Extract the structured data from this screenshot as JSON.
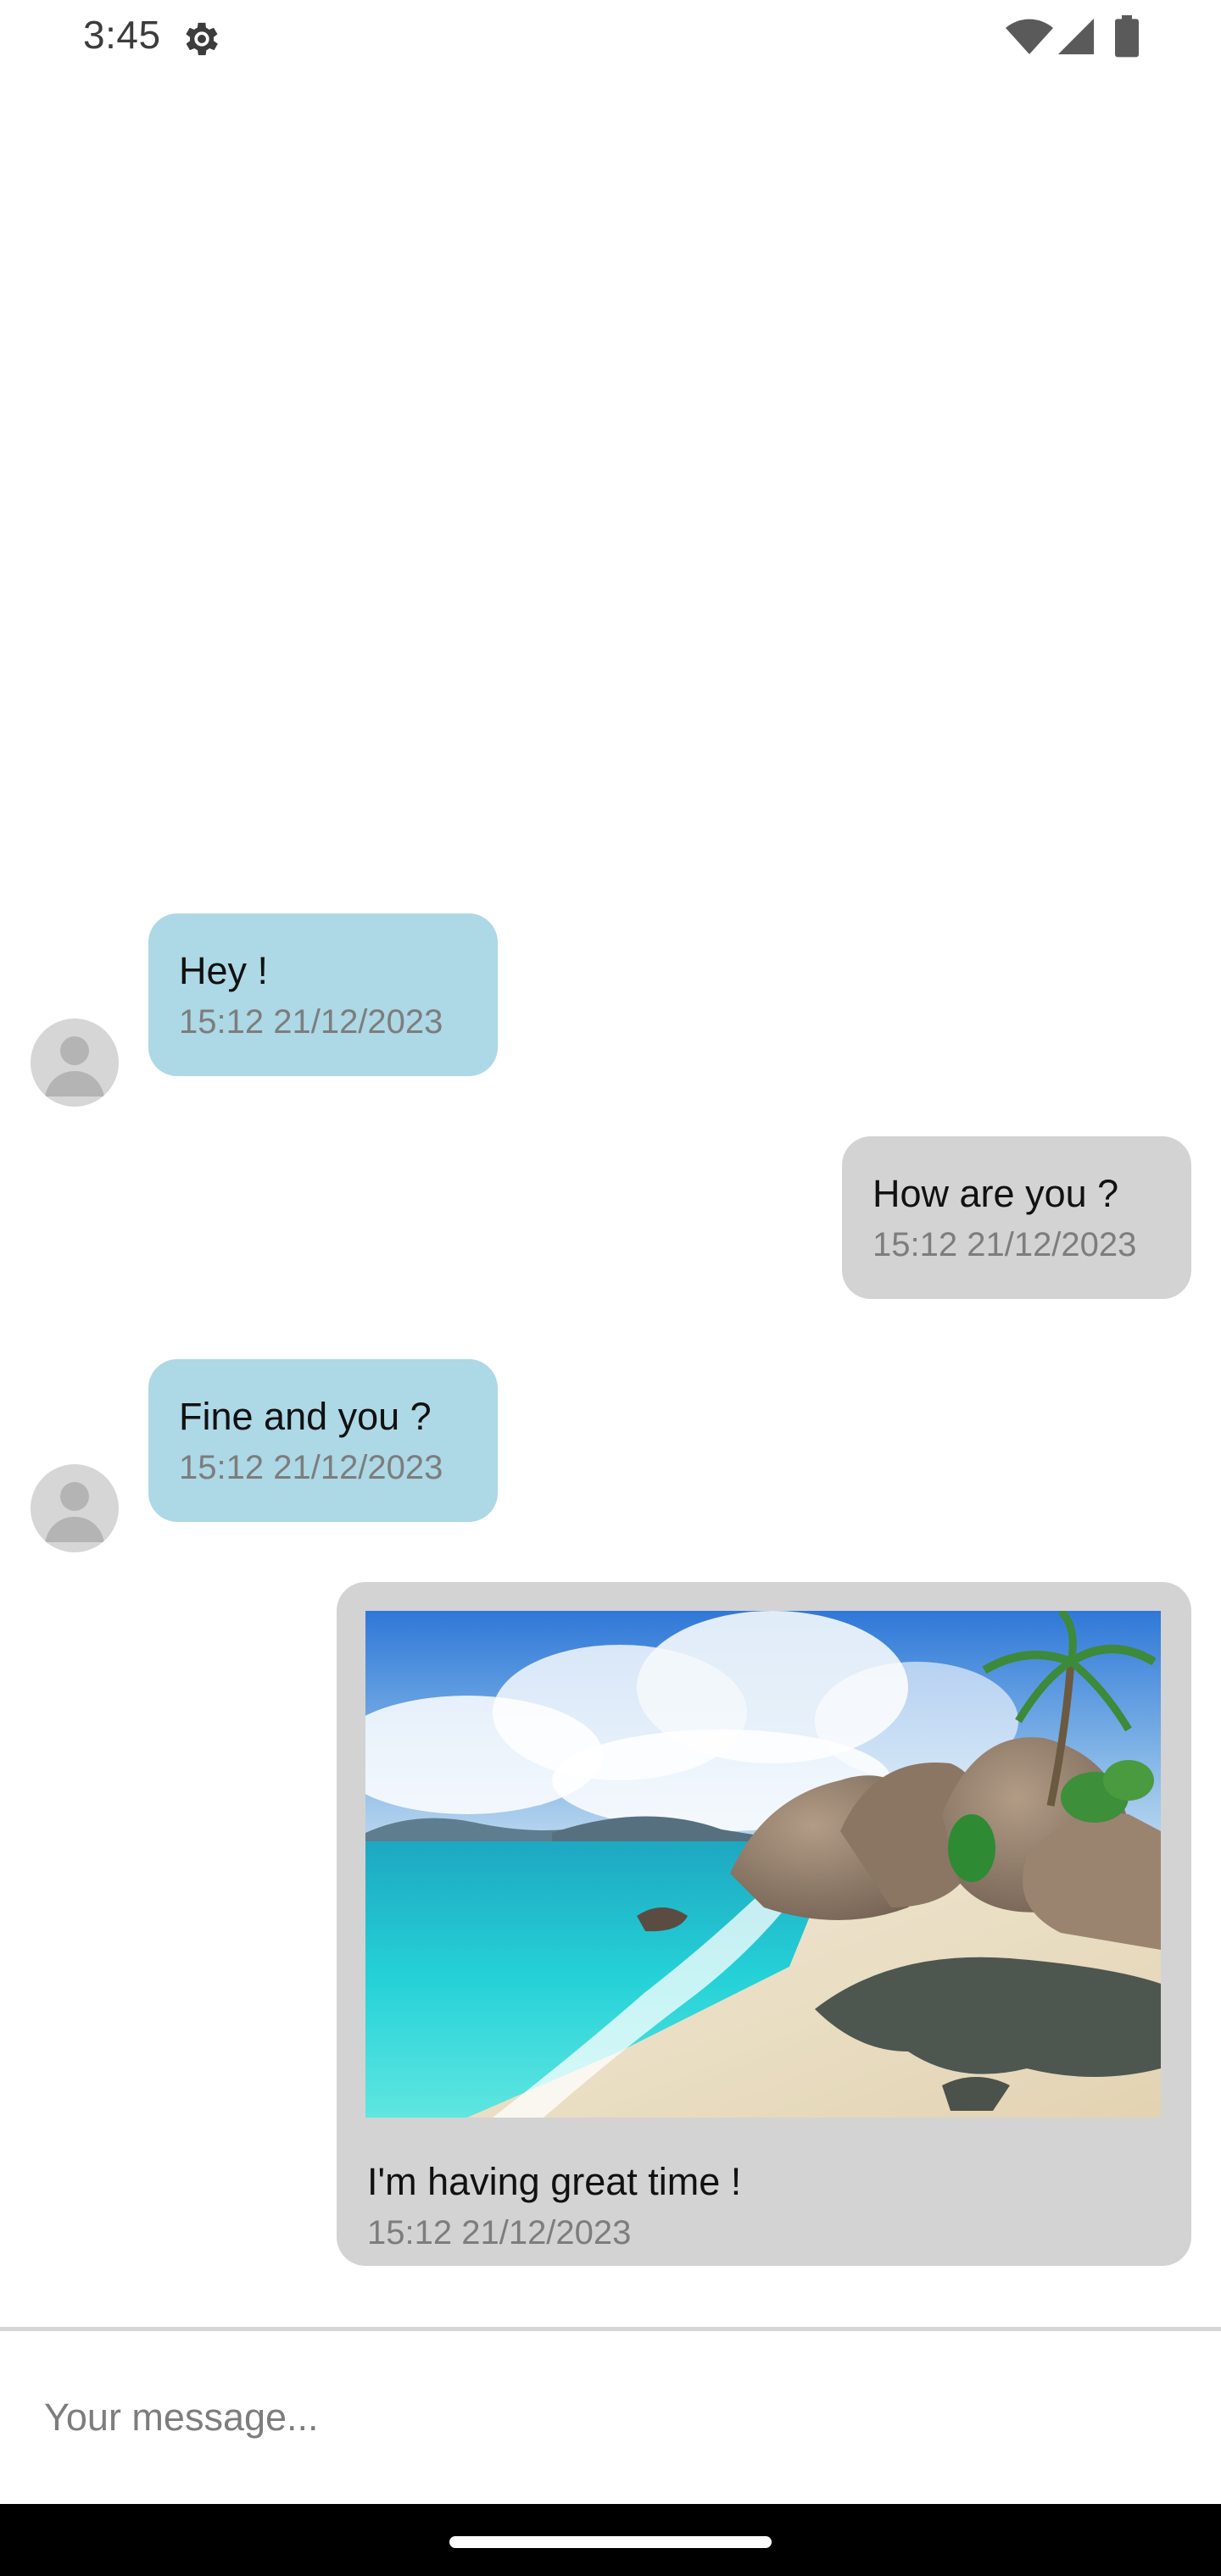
{
  "status_bar": {
    "time": "3:45",
    "icons": [
      "gear-icon",
      "wifi-icon",
      "signal-icon",
      "battery-icon"
    ]
  },
  "messages": [
    {
      "direction": "incoming",
      "text": "Hey !",
      "timestamp": "15:12 21/12/2023",
      "has_avatar": true
    },
    {
      "direction": "outgoing",
      "text": "How are you ?",
      "timestamp": "15:12 21/12/2023",
      "has_avatar": false
    },
    {
      "direction": "incoming",
      "text": "Fine and you ?",
      "timestamp": "15:12 21/12/2023",
      "has_avatar": true
    },
    {
      "direction": "outgoing",
      "text": "I'm having great time !",
      "timestamp": "15:12 21/12/2023",
      "has_avatar": false,
      "attachment": "beach-photo"
    }
  ],
  "composer": {
    "placeholder": "Your message..."
  },
  "colors": {
    "incoming_bubble": "#add8e6",
    "outgoing_bubble": "#d3d3d3",
    "timestamp": "#7d7d7d",
    "nav_bar": "#000000"
  }
}
